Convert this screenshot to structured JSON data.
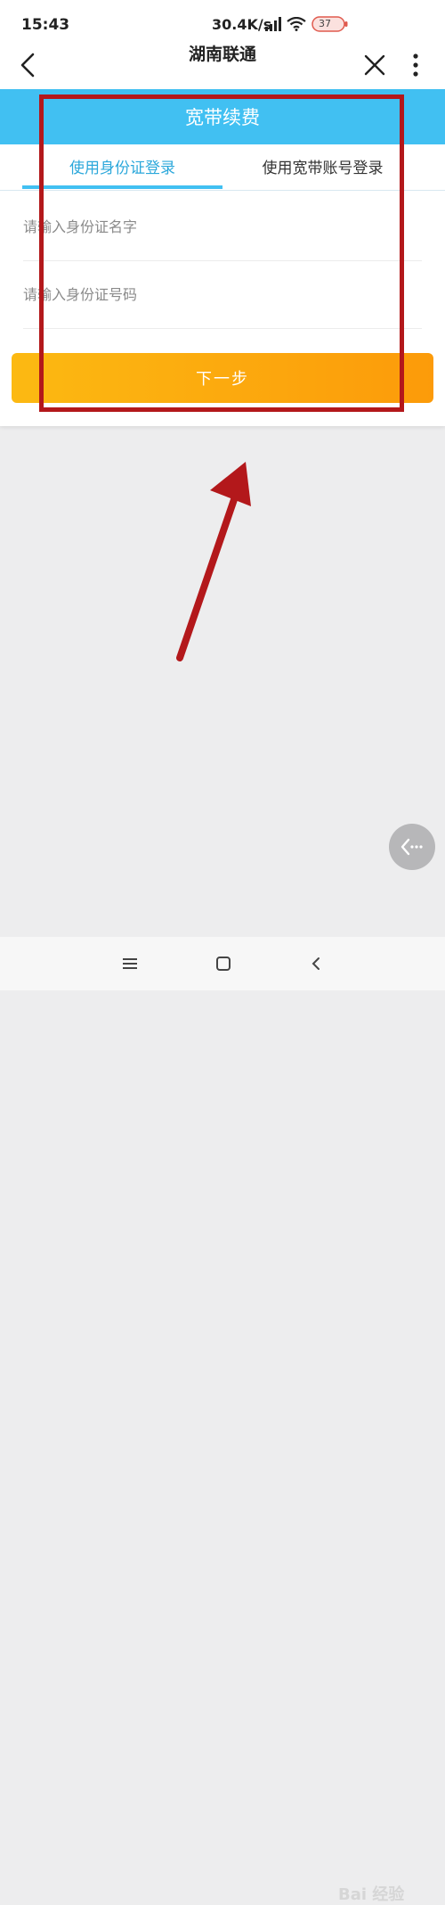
{
  "status_bar": {
    "time": "15:43",
    "network_speed": "30.4K/s",
    "battery_level": "37"
  },
  "nav_bar": {
    "title": "湖南联通"
  },
  "page": {
    "header_title": "宽带续费",
    "tabs": [
      {
        "label": "使用身份证登录",
        "active": true
      },
      {
        "label": "使用宽带账号登录",
        "active": false
      }
    ],
    "name_field": {
      "placeholder": "请输入身份证名字",
      "value": ""
    },
    "id_field": {
      "placeholder": "请输入身份证号码",
      "value": ""
    },
    "next_button": "下一步"
  },
  "watermark": "Bai 经验",
  "colors": {
    "accent_blue": "#41c0f2",
    "button_orange": "#fca90e",
    "annotation_red": "#b3181b"
  }
}
